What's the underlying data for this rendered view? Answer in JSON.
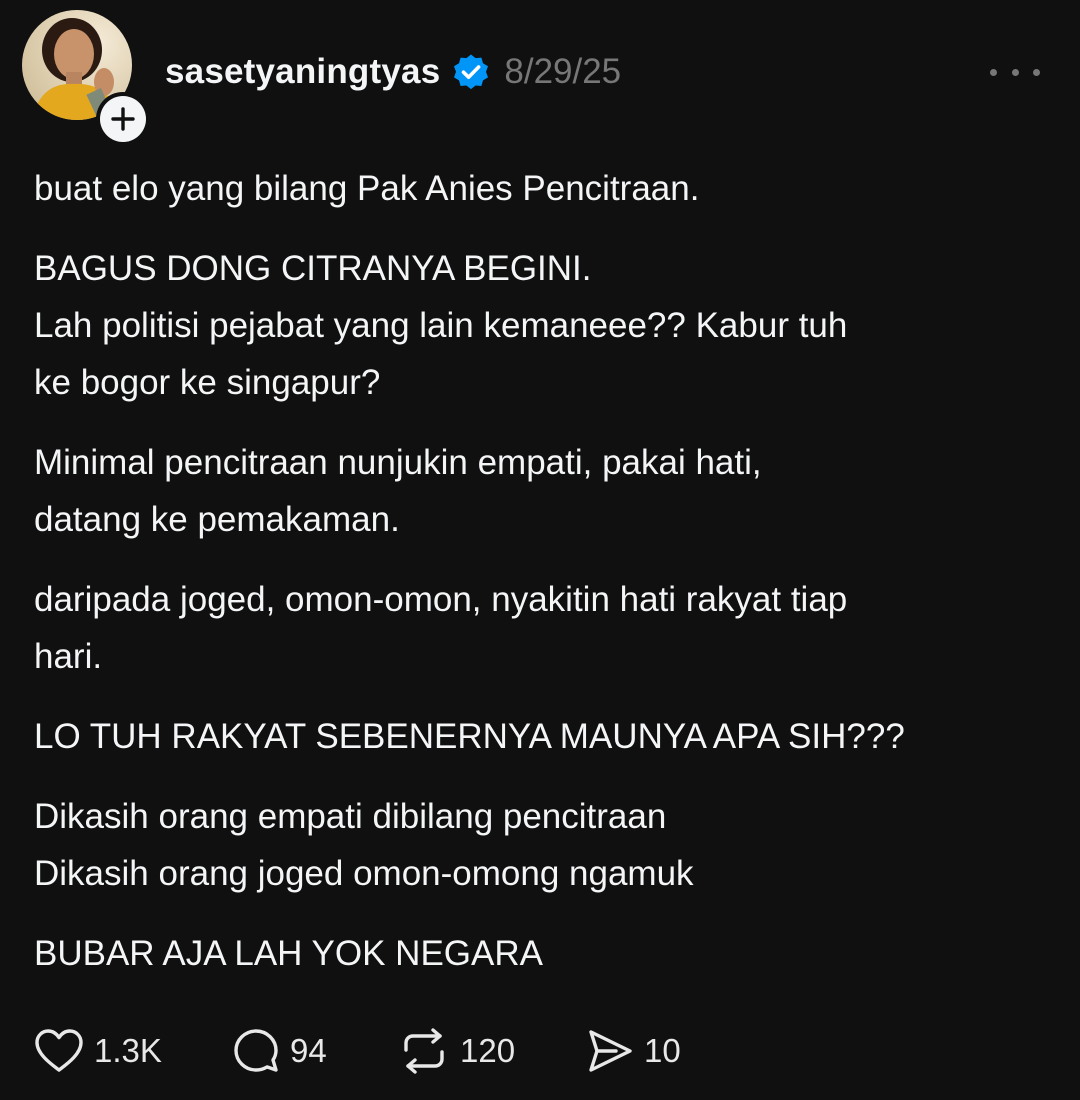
{
  "post": {
    "username": "sasetyaningtyas",
    "timestamp": "8/29/25",
    "paragraphs": [
      "buat elo yang bilang Pak Anies Pencitraan.",
      "BAGUS DONG CITRANYA BEGINI.\nLah politisi pejabat yang lain kemaneee?? Kabur tuh\nke bogor ke singapur?",
      "Minimal pencitraan nunjukin empati, pakai hati,\ndatang ke pemakaman.",
      "daripada joged, omon-omon, nyakitin hati rakyat tiap\nhari.",
      "LO TUH RAKYAT SEBENERNYA MAUNYA APA SIH???",
      "Dikasih orang empati dibilang pencitraan\nDikasih orang joged omon-omong ngamuk",
      "BUBAR AJA LAH YOK NEGARA"
    ]
  },
  "actions": {
    "likes": "1.3K",
    "replies": "94",
    "reposts": "120",
    "shares": "10"
  },
  "icons": {
    "verified": "verified-badge-icon",
    "follow": "plus-icon",
    "more": "more-dots-icon",
    "like": "heart-icon",
    "reply": "comment-bubble-icon",
    "repost": "repost-arrows-icon",
    "share": "send-icon"
  },
  "colors": {
    "background": "#101010",
    "text": "#f3f5f7",
    "muted": "#777777",
    "verified": "#0095f6"
  }
}
